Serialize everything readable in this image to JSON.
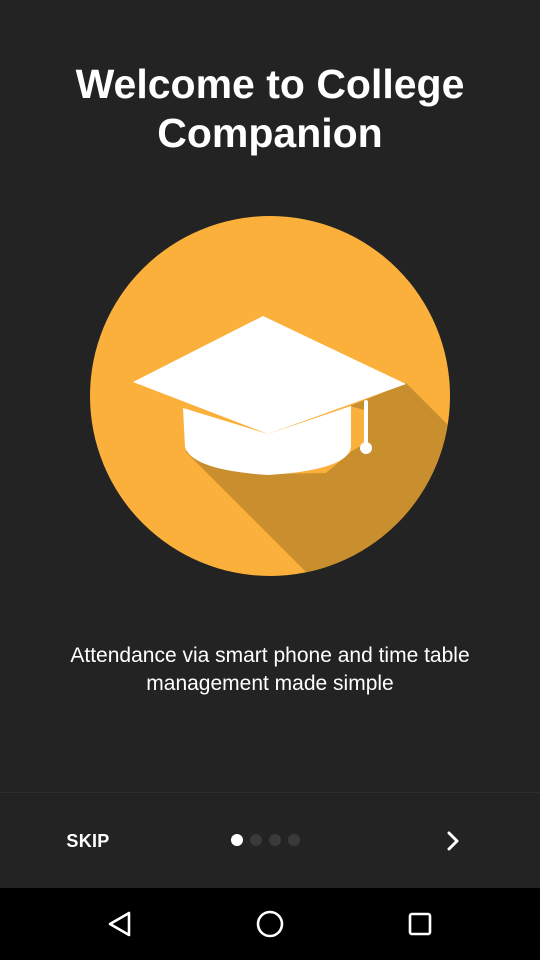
{
  "onboarding": {
    "title": "Welcome to College Companion",
    "description": "Attendance via smart phone and time table management made simple",
    "hero_icon": "graduation-cap-icon",
    "colors": {
      "background": "#232323",
      "circle": "#FBB03B",
      "shadow": "#C98F2E",
      "icon": "#FFFFFF"
    }
  },
  "bottom_bar": {
    "skip_label": "SKIP",
    "page_count": 4,
    "current_page": 1,
    "next_icon": "chevron-right-icon"
  },
  "system_nav": {
    "back_icon": "back-triangle-icon",
    "home_icon": "home-circle-icon",
    "recents_icon": "recents-square-icon"
  }
}
